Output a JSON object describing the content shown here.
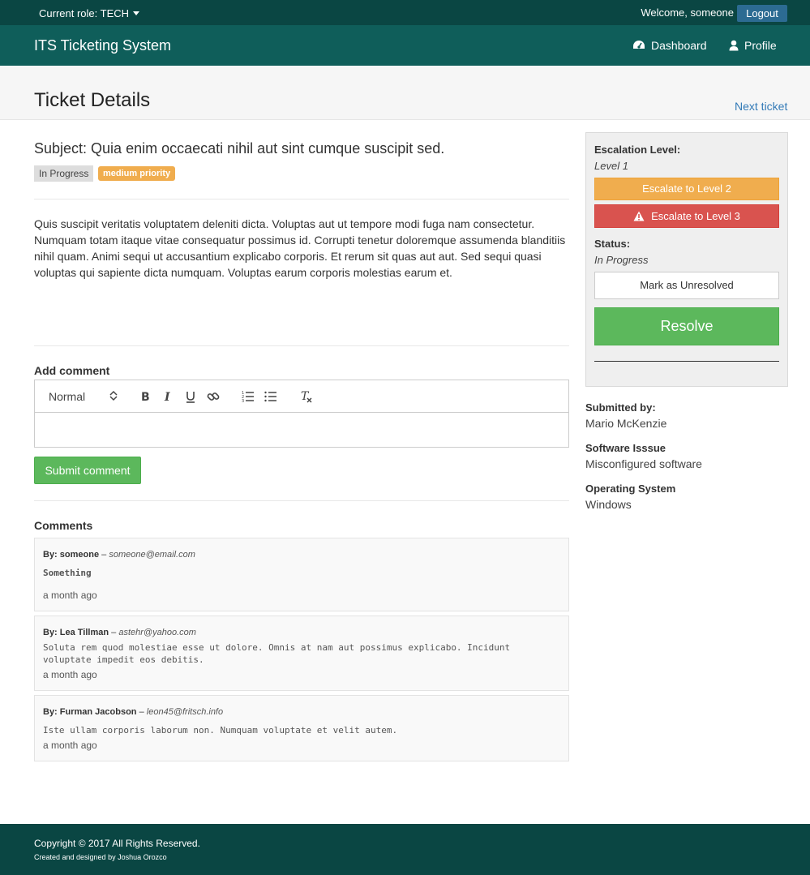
{
  "topbar": {
    "role_label": "Current role: TECH",
    "welcome": "Welcome, someone",
    "logout": "Logout"
  },
  "navbar": {
    "brand": "ITS Ticketing System",
    "items": [
      {
        "label": "Dashboard",
        "icon": "dashboard-icon"
      },
      {
        "label": "Profile",
        "icon": "user-icon"
      }
    ]
  },
  "header": {
    "title": "Ticket Details",
    "next_link": "Next ticket"
  },
  "ticket": {
    "subject": "Subject: Quia enim occaecati nihil aut sint cumque suscipit sed.",
    "status_badge": "In Progress",
    "priority_badge": "medium priority",
    "description": "Quis suscipit veritatis voluptatem deleniti dicta. Voluptas aut ut tempore modi fuga nam consectetur. Numquam totam itaque vitae consequatur possimus id. Corrupti tenetur doloremque assumenda blanditiis nihil quam. Animi sequi ut accusantium explicabo corporis. Et rerum sit quas aut aut. Sed sequi quasi voluptas qui sapiente dicta numquam. Voluptas earum corporis molestias earum et."
  },
  "comment_form": {
    "label": "Add comment",
    "format_select": "Normal",
    "submit": "Submit comment"
  },
  "comments": {
    "label": "Comments",
    "items": [
      {
        "by": "By: someone",
        "sep": "–",
        "email": "someone@email.com",
        "body": "Something",
        "time": "a month ago"
      },
      {
        "by": "By: Lea Tillman",
        "sep": "–",
        "email": "astehr@yahoo.com",
        "body": "Soluta rem quod molestiae esse ut dolore. Omnis at nam aut possimus explicabo. Incidunt voluptate impedit eos debitis.",
        "time": "a month ago"
      },
      {
        "by": "By: Furman Jacobson",
        "sep": "–",
        "email": "leon45@fritsch.info",
        "body": "Iste ullam corporis laborum non. Numquam voluptate et velit autem.",
        "time": "a month ago"
      }
    ]
  },
  "sidebar": {
    "escalation_label": "Escalation Level:",
    "escalation_value": "Level 1",
    "escalate2": "Escalate to Level 2",
    "escalate3": "Escalate to Level 3",
    "status_label": "Status:",
    "status_value": "In Progress",
    "mark_unresolved": "Mark as Unresolved",
    "resolve": "Resolve",
    "submitted_label": "Submitted by:",
    "submitted_value": "Mario McKenzie",
    "software_label": "Software Isssue",
    "software_value": "Misconfigured software",
    "os_label": "Operating System",
    "os_value": "Windows"
  },
  "footer": {
    "copyright": "Copyright © 2017 All Rights Reserved.",
    "credit": "Created and designed by Joshua Orozco"
  },
  "colors": {
    "topbar": "#0a4643",
    "navbar": "#0f5e5a",
    "success": "#5cb85c",
    "warning": "#f0ad4e",
    "danger": "#d9534f",
    "link": "#337ab7"
  }
}
